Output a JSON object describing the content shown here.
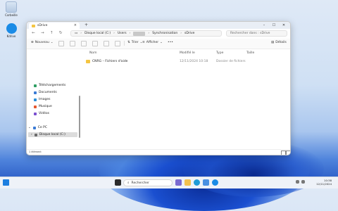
{
  "desktop": {
    "icons": [
      {
        "label": "Corbeille"
      },
      {
        "label": "Kdrive"
      }
    ]
  },
  "window": {
    "tab_title": "sDrive",
    "addr": {
      "crumbs": [
        "Disque local (C:)",
        "Users",
        "Synchronisation",
        "sDrive"
      ]
    },
    "search_placeholder": "Rechercher dans : sDrive",
    "toolbar": {
      "new_label": "Nouveau",
      "sort_label": "Trier",
      "view_label": "Afficher",
      "details_label": "Détails"
    },
    "sidebar": {
      "items": [
        "Téléchargements",
        "Documents",
        "Images",
        "Musique",
        "Vidéos"
      ],
      "pc_label": "Ce PC",
      "disk_label": "Disque local (C:)"
    },
    "columns": {
      "name": "Nom",
      "modified": "Modifié le",
      "type": "Type",
      "size": "Taille"
    },
    "rows": [
      {
        "name": "CNRG – Fichiers d'aide",
        "modified": "12/11/2024 10:18",
        "type": "Dossier de fichiers",
        "size": ""
      }
    ],
    "status": "1 élément"
  },
  "taskbar": {
    "search_label": "Rechercher",
    "time": "10:38",
    "date": "12/11/2024"
  }
}
